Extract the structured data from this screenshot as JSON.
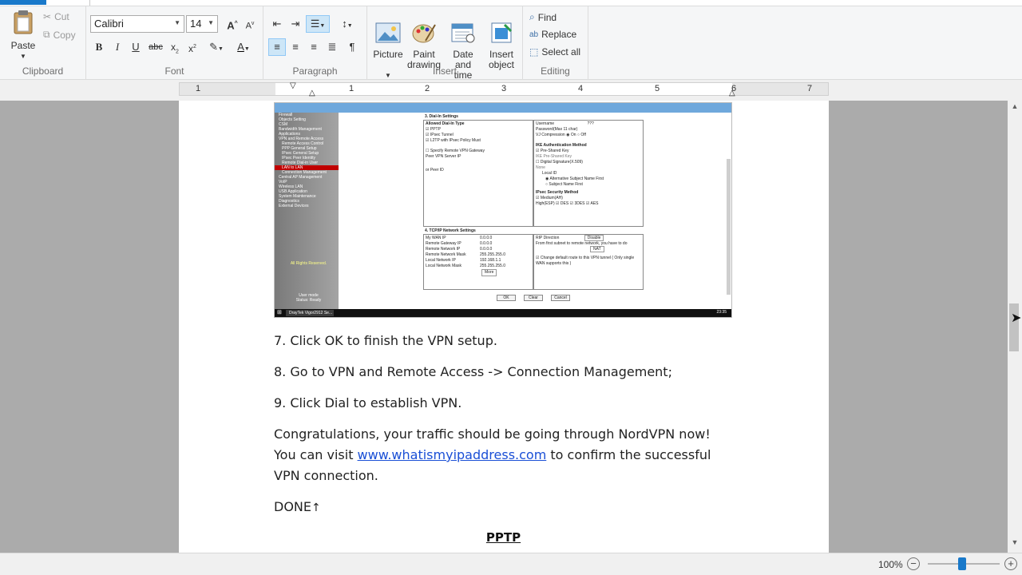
{
  "ribbon": {
    "clipboard": {
      "label": "Clipboard",
      "paste": "Paste",
      "cut": "Cut",
      "copy": "Copy"
    },
    "font": {
      "label": "Font",
      "family": "Calibri",
      "size": "14"
    },
    "paragraph": {
      "label": "Paragraph"
    },
    "insert": {
      "label": "Insert",
      "picture": "Picture",
      "paint": "Paint\ndrawing",
      "datetime": "Date and\ntime",
      "object": "Insert\nobject"
    },
    "editing": {
      "label": "Editing",
      "find": "Find",
      "replace": "Replace",
      "select_all": "Select all"
    }
  },
  "ruler": {
    "numbers": [
      "1",
      "1",
      "2",
      "3",
      "4",
      "5",
      "6",
      "7"
    ]
  },
  "document": {
    "screenshot": {
      "nav_items": [
        "Firewall",
        "Objects Setting",
        "CSM",
        "Bandwidth Management",
        "Applications",
        "VPN and Remote Access",
        "Remote Access Control",
        "PPP General Setup",
        "IPsec General Setup",
        "IPsec Peer Identity",
        "Remote Dial-in User",
        "LAN to LAN",
        "Connection Management",
        "Central AP Management",
        "VoIP",
        "Wireless LAN",
        "USB Application",
        "System Maintenance",
        "Diagnostics",
        "External Devices"
      ],
      "rights": "All Rights Reserved.",
      "footer": "User mode\nStatus: Ready",
      "section3": "3. Dial-In Settings",
      "allowed_type": "Allowed Dial-In Type",
      "pptp": "PPTP",
      "ipsec": "IPsec Tunnel",
      "l2tp": "L2TP with IPsec Policy  Must",
      "specify_remote": "Specify Remote VPN Gateway",
      "peer_vpn": "Peer VPN Server IP",
      "or_peer_id": "or Peer ID",
      "username": "Username",
      "username_val": "???",
      "password": "Password(Max 11 char)",
      "vj": "VJ Compression",
      "vj_on": "On",
      "vj_off": "Off",
      "ike": "IKE Authentication Method",
      "psk": "Pre-Shared Key",
      "ike_psk": "IKE Pre-Shared Key",
      "digsig": "Digital Signature(X.509)",
      "none": "None",
      "local_id": "Local ID",
      "alt_subject": "Alternative Subject Name First",
      "subject_name": "Subject Name First",
      "ipsec_sec": "IPsec Security Method",
      "medium": "Medium(AH)",
      "high": "High(ESP)",
      "des": "DES",
      "tdes": "3DES",
      "aes": "AES",
      "section4": "4. TCP/IP Network Settings",
      "tcpip_labels": [
        "My WAN IP",
        "Remote Gateway IP",
        "Remote Network IP",
        "Remote Network Mask",
        "Local Network IP",
        "Local Network Mask"
      ],
      "tcpip_values": [
        "0.0.0.0",
        "0.0.0.0",
        "0.0.0.0",
        "255.255.255.0",
        "192.168.1.1",
        "255.255.255.0"
      ],
      "more": "More",
      "rip": "RIP Direction",
      "rip_val": "Disable",
      "from_first": "From first subnet to remote network, you have to do",
      "nat": "NAT",
      "change_route": "Change default route to this VPN tunnel ( Only single WAN supports this )",
      "ok": "OK",
      "clear": "Clear",
      "cancel": "Cancel",
      "taskbar_item": "DrayTek Vigor2912 Se...",
      "clock": "23:35"
    },
    "p7": "7. Click OK to finish the VPN setup.",
    "p8": "8. Go to VPN and Remote Access -> Connection Management;",
    "p9": "9. Click Dial to establish VPN.",
    "congrats_before": "Congratulations, your traffic should be going through NordVPN now! You can visit ",
    "link": "www.whatismyipaddress.com",
    "congrats_after": " to confirm the successful VPN connection.",
    "done": "DONE",
    "heading": "PPTP"
  },
  "status": {
    "zoom": "100%"
  },
  "colors": {
    "accent": "#1979ca",
    "link": "#1a4fd6",
    "highlight": "#c00000"
  }
}
